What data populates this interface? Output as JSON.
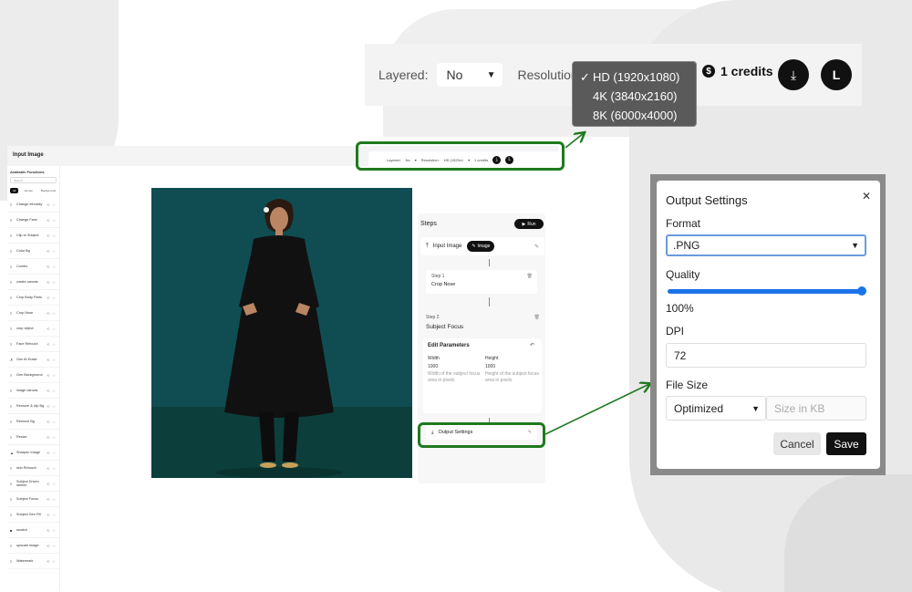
{
  "toolbar": {
    "layered_label": "Layered:",
    "layered_value": "No",
    "resolution_label": "Resolution:",
    "resolution_options": [
      "HD (1920x1080)",
      "4K (3840x2160)",
      "8K (6000x4000)"
    ],
    "resolution_selected_mark": "✓",
    "credits": "1 credits",
    "coin_symbol": "$"
  },
  "app": {
    "title": "Input Image",
    "sidebar": {
      "heading": "Available Functions",
      "search_placeholder": "Search...",
      "tabs": [
        "All",
        "Human",
        "Background"
      ],
      "items": [
        {
          "icon": "≡",
          "label": "Change ethnicity"
        },
        {
          "icon": "≡",
          "label": "Change Face"
        },
        {
          "icon": "≡",
          "label": "Clip to Subject"
        },
        {
          "icon": "≡",
          "label": "Color Bg"
        },
        {
          "icon": "≡",
          "label": "Combo"
        },
        {
          "icon": "≡",
          "label": "create canvas"
        },
        {
          "icon": "≡",
          "label": "Crop Body Parts"
        },
        {
          "icon": "≡",
          "label": "Crop Nose"
        },
        {
          "icon": "≡",
          "label": "crop object"
        },
        {
          "icon": "≡",
          "label": "Face Retouch"
        },
        {
          "icon": "✗",
          "label": "Gen AI Erase"
        },
        {
          "icon": "≡",
          "label": "Gen Background"
        },
        {
          "icon": "≡",
          "label": "image canvas"
        },
        {
          "icon": "≡",
          "label": "Remove & clip Bg"
        },
        {
          "icon": "≡",
          "label": "Remove Bg"
        },
        {
          "icon": "≡",
          "label": "Resize"
        },
        {
          "icon": "▲",
          "label": "Sharpen Image"
        },
        {
          "icon": "≡",
          "label": "skin Retouch"
        },
        {
          "icon": "≡",
          "label": "Subject Driven stretch"
        },
        {
          "icon": "≡",
          "label": "Subject Focus"
        },
        {
          "icon": "≡",
          "label": "Subject Gen Fill"
        },
        {
          "icon": "■",
          "label": "swatch"
        },
        {
          "icon": "≡",
          "label": "upscale image"
        },
        {
          "icon": "≡",
          "label": "Watermark"
        }
      ]
    },
    "mini_toolbar": {
      "layered_label": "Layered:",
      "layered_value": "No",
      "resolution_label": "Resolution:",
      "resolution_value": "HD (1920x1",
      "credits": "1 credits"
    },
    "steps": {
      "heading": "Steps",
      "run_label": "Run",
      "input_label": "Input Image",
      "input_chip": "Image",
      "step1_tag": "Step 1",
      "step1_name": "Crop Nose",
      "step2_tag": "Step 2",
      "step2_name": "Subject Focus",
      "params_heading": "Edit Parameters",
      "width_label": "Width",
      "width_value": "1000",
      "width_help": "Width of the subject focus area in pixels",
      "height_label": "Height",
      "height_value": "1000",
      "height_help": "Height of the subject focus area in pixels",
      "output_label": "Output Settings"
    }
  },
  "modal": {
    "title": "Output Settings",
    "format_label": "Format",
    "format_value": ".PNG",
    "quality_label": "Quality",
    "quality_value": "100%",
    "quality_fraction": 1.0,
    "dpi_label": "DPI",
    "dpi_value": "72",
    "filesize_label": "File Size",
    "filesize_value": "Optimized",
    "kb_placeholder": "Size in KB",
    "cancel_label": "Cancel",
    "save_label": "Save"
  },
  "colors": {
    "highlight": "#1e7a1e",
    "accent": "#1a73e8",
    "dark": "#111111"
  }
}
